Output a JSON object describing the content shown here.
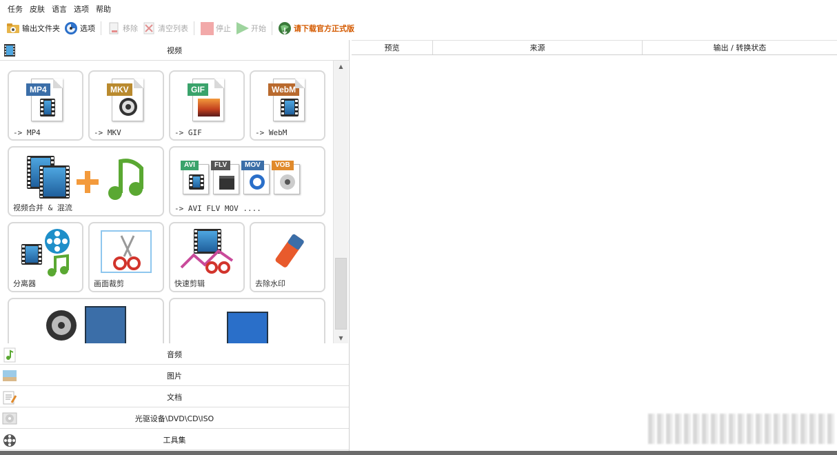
{
  "menu": [
    "任务",
    "皮肤",
    "语言",
    "选项",
    "帮助"
  ],
  "toolbar": {
    "output_folder": "输出文件夹",
    "options": "选项",
    "remove": "移除",
    "clear_list": "清空列表",
    "stop": "停止",
    "start": "开始",
    "download": "请下载官方正式版"
  },
  "categories": {
    "video": "视频",
    "audio": "音频",
    "image": "图片",
    "document": "文档",
    "disc": "光驱设备\\DVD\\CD\\ISO",
    "tools": "工具集"
  },
  "tiles": {
    "mp4": {
      "badge": "MP4",
      "label": "-> MP4"
    },
    "mkv": {
      "badge": "MKV",
      "label": "-> MKV"
    },
    "gif": {
      "badge": "GIF",
      "label": "-> GIF"
    },
    "webm": {
      "badge": "WebM",
      "label": "-> WebM"
    },
    "merge": {
      "label": "视频合并 & 混流"
    },
    "avi": {
      "badges": [
        "AVI",
        "FLV",
        "MOV",
        "VOB"
      ],
      "label": "-> AVI FLV MOV ...."
    },
    "splitter": {
      "label": "分离器"
    },
    "crop": {
      "label": "画面裁剪"
    },
    "quick_clip": {
      "label": "快速剪辑"
    },
    "remove_watermark": {
      "label": "去除水印"
    }
  },
  "table": {
    "columns": [
      "预览",
      "来源",
      "输出 / 转换状态"
    ]
  },
  "colors": {
    "mp4": "#3b6ea8",
    "mkv": "#b98a2e",
    "gif": "#3aa36b",
    "webm": "#b96a2e",
    "download": "#d45a00"
  }
}
